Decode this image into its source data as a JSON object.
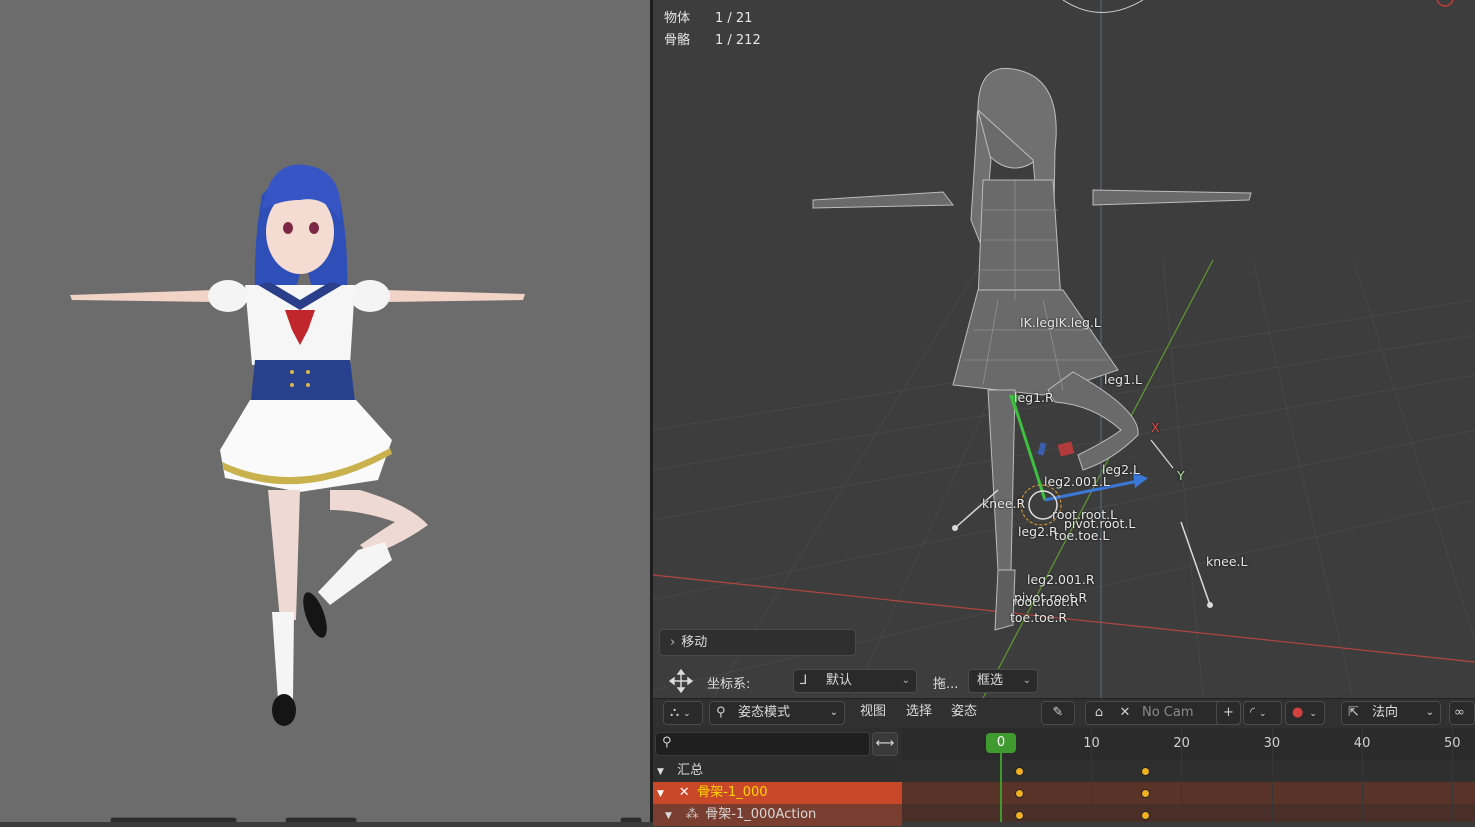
{
  "viewport": {
    "stats": [
      {
        "label": "物体",
        "value": "1 / 21"
      },
      {
        "label": "骨骼",
        "value": "1 / 212"
      }
    ],
    "bone_labels": [
      {
        "text": "IK.legIK.leg.L"
      },
      {
        "text": "leg1.L"
      },
      {
        "text": "leg1.R"
      },
      {
        "text": "leg2.L"
      },
      {
        "text": "X"
      },
      {
        "text": "Y"
      },
      {
        "text": "leg2.001.L"
      },
      {
        "text": "knee.R"
      },
      {
        "text": "root.root.L"
      },
      {
        "text": "pivot.root.L"
      },
      {
        "text": "leg2.R"
      },
      {
        "text": "toe.toe.L"
      },
      {
        "text": "knee.L"
      },
      {
        "text": "leg2.001.R"
      },
      {
        "text": "pivot.root.R"
      },
      {
        "text": "root.root.R"
      },
      {
        "text": "toe.toe.R"
      }
    ],
    "last_operator": "移动",
    "tool_settings": {
      "orientation_label": "坐标系:",
      "orientation_value": "默认",
      "drag_label": "拖...",
      "drag_value": "框选"
    }
  },
  "header": {
    "mode": "姿态模式",
    "menus": [
      "视图",
      "选择",
      "姿态"
    ],
    "camera": "No Cam",
    "transform_orientation": "法向"
  },
  "timeline": {
    "search_placeholder": "",
    "channels": [
      {
        "label": "汇总"
      },
      {
        "label": "骨架-1_000"
      },
      {
        "label": "骨架-1_000Action"
      }
    ],
    "frame_numbers": [
      "10",
      "20",
      "30",
      "40",
      "50"
    ],
    "current_frame": "0",
    "keyframes": [
      2,
      16
    ]
  },
  "colors": {
    "selected_channel_bg": "#c9482a",
    "selected_channel_text": "#ffd700",
    "playhead": "#3f9b2f",
    "keyframe": "#f0b020",
    "x_axis": "#b3453e",
    "y_axis": "#5e9a2f"
  }
}
